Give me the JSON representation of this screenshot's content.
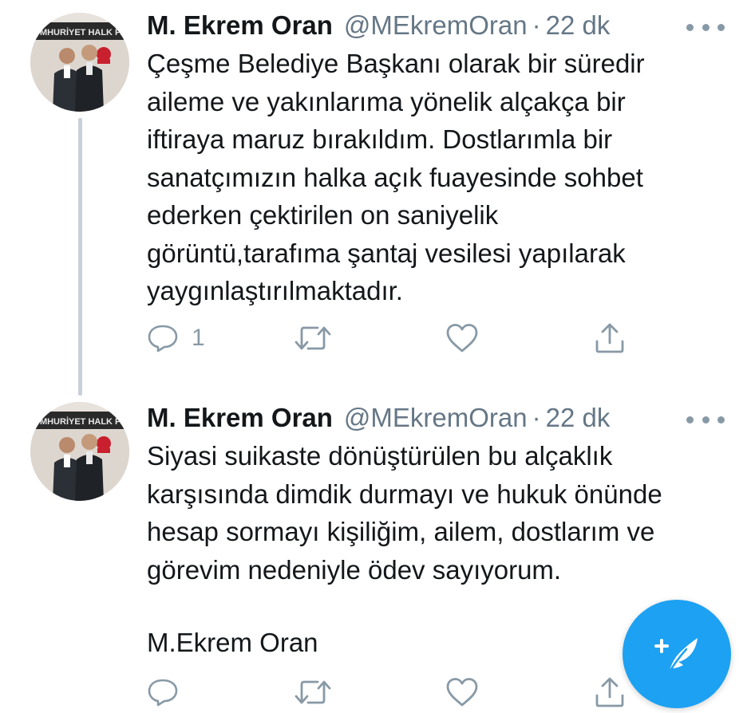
{
  "tweets": [
    {
      "author_name": "M. Ekrem Oran",
      "handle": "@MEkremOran",
      "separator": "·",
      "time": "22 dk",
      "avatar_banner": "UMHURİYET HALK PA",
      "lines": [
        "Çeşme Belediye Başkanı olarak bir süredir",
        "aileme ve yakınlarıma yönelik alçakça bir",
        "iftiraya maruz bırakıldım. Dostlarımla bir",
        "sanatçımızın halka açık fuayesinde sohbet",
        "ederken çektirilen on saniyelik",
        "görüntü,tarafıma şantaj vesilesi yapılarak",
        "yaygınlaştırılmaktadır."
      ],
      "reply_count": "1"
    },
    {
      "author_name": "M. Ekrem Oran",
      "handle": "@MEkremOran",
      "separator": "·",
      "time": "22 dk",
      "avatar_banner": "UMHURİYET HALK PA",
      "lines": [
        "Siyasi suikaste dönüştürülen bu alçaklık",
        "karşısında dimdik durmayı ve hukuk önünde",
        "hesap sormayı kişiliğim, ailem, dostlarım ve",
        "görevim nedeniyle ödev sayıyorum."
      ],
      "signature": "M.Ekrem Oran",
      "reply_count": ""
    }
  ],
  "icons": {
    "more": "more-dots-icon",
    "reply": "reply-icon",
    "retweet": "retweet-icon",
    "like": "heart-icon",
    "share": "share-icon",
    "compose": "compose-feather-icon"
  },
  "colors": {
    "accent": "#1da1f2",
    "secondary_text": "#657786",
    "icon_gray": "#8899a6",
    "thread_line": "#c9d1d8"
  }
}
